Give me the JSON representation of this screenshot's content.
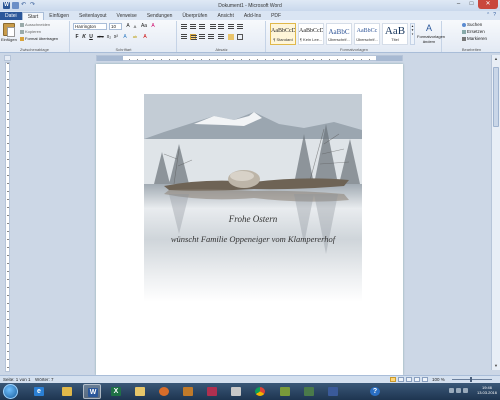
{
  "window": {
    "title": "Dokument1 - Microsoft Word",
    "controls": [
      "–",
      "□",
      "✕"
    ]
  },
  "tabs": [
    "Datei",
    "Start",
    "Einfügen",
    "Seitenlayout",
    "Verweise",
    "Sendungen",
    "Überprüfen",
    "Ansicht",
    "Add-Ins",
    "PDF"
  ],
  "active_tab": "Start",
  "ribbon": {
    "clipboard": {
      "paste": "Einfügen",
      "cut": "Ausschneiden",
      "copy": "Kopieren",
      "format_painter": "Format übertragen",
      "group_label": "Zwischenablage"
    },
    "font": {
      "name": "Harrington",
      "size": "10",
      "bold": "F",
      "italic": "K",
      "underline": "U",
      "strike": "abc",
      "subscript": "x₂",
      "superscript": "x²",
      "text_effects": "A",
      "highlight": "ab",
      "font_color": "A",
      "grow": "A",
      "shrink": "A",
      "case": "Aa",
      "clear": "A",
      "group_label": "Schriftart"
    },
    "paragraph": {
      "group_label": "Absatz"
    },
    "styles": {
      "items": [
        {
          "preview": "AaBbCcDc",
          "name": "¶ Standard"
        },
        {
          "preview": "AaBbCcDc",
          "name": "¶ Kein Lee..."
        },
        {
          "preview": "AaBbC",
          "name": "Überschrif..."
        },
        {
          "preview": "AaBbCc",
          "name": "Überschrif..."
        },
        {
          "preview": "AaB",
          "name": "Titel"
        }
      ],
      "change_styles": "Formatvorlagen ändern",
      "group_label": "Formatvorlagen"
    },
    "editing": {
      "find": "Suchen",
      "replace": "Ersetzen",
      "select": "Markieren",
      "group_label": "Bearbeiten"
    }
  },
  "document": {
    "line1": "Frohe Ostern",
    "line2": "wünscht Familie Oppeneiger vom Klampererhof"
  },
  "status": {
    "page": "Seite: 1 von 1",
    "words": "Wörter: 7",
    "zoom": "100 %"
  },
  "taskbar": {
    "time": "19:46",
    "date": "13.03.2016",
    "tray_lang": "DE"
  },
  "colors": {
    "file_tab": "#2b579a",
    "taskbar": "#1e3550",
    "close": "#c9473c"
  }
}
